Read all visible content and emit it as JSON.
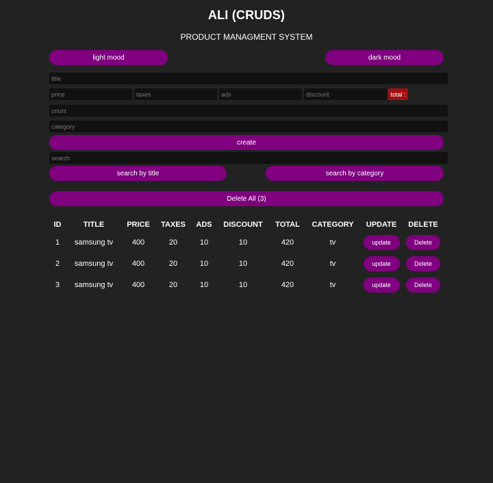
{
  "header": {
    "title": "ALI (CRUDS)",
    "subtitle": "PRODUCT MANAGMENT SYSTEM"
  },
  "mode_buttons": {
    "light": "light mood",
    "dark": "dark mood"
  },
  "form": {
    "title_placeholder": "title",
    "price_placeholder": "price",
    "taxes_placeholder": "taxes",
    "ads_placeholder": "ads",
    "discount_placeholder": "discount",
    "total_label": "total :",
    "count_placeholder": "count",
    "category_placeholder": "category",
    "create_label": "create"
  },
  "search": {
    "placeholder": "search",
    "by_title_label": "search by title",
    "by_category_label": "search by category"
  },
  "delete_all_label": "Delete All (3)",
  "table": {
    "headers": [
      "ID",
      "TITLE",
      "PRICE",
      "TAXES",
      "ADS",
      "DISCOUNT",
      "TOTAL",
      "CATEGORY",
      "UPDATE",
      "DELETE"
    ],
    "rows": [
      {
        "id": "1",
        "title": "samsung tv",
        "price": "400",
        "taxes": "20",
        "ads": "10",
        "discount": "10",
        "total": "420",
        "category": "tv",
        "update": "update",
        "delete": "Delete"
      },
      {
        "id": "2",
        "title": "samsung tv",
        "price": "400",
        "taxes": "20",
        "ads": "10",
        "discount": "10",
        "total": "420",
        "category": "tv",
        "update": "update",
        "delete": "Delete"
      },
      {
        "id": "3",
        "title": "samsung tv",
        "price": "400",
        "taxes": "20",
        "ads": "10",
        "discount": "10",
        "total": "420",
        "category": "tv",
        "update": "update",
        "delete": "Delete"
      }
    ]
  },
  "colors": {
    "background": "#222222",
    "accent": "#800080",
    "input_bg": "#111111",
    "total_bg": "#a01010"
  }
}
